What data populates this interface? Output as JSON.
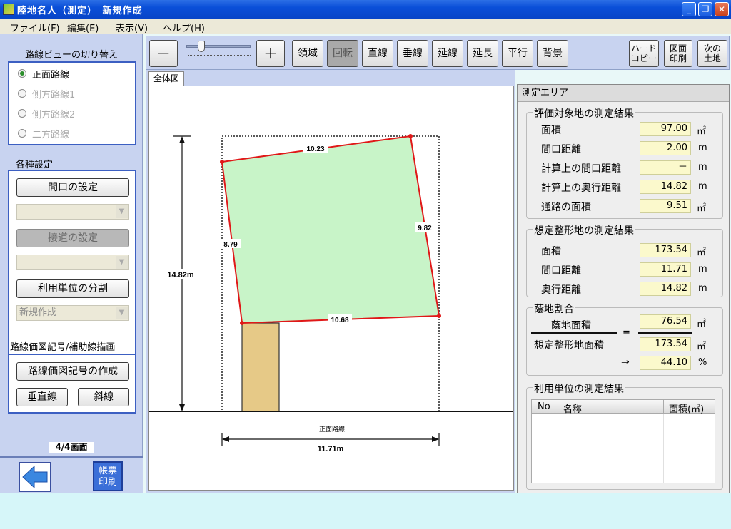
{
  "window": {
    "title": "陸地名人（測定）　新規作成",
    "minimize_icon": "minimize-icon",
    "maximize_icon": "restore-icon",
    "close_icon": "close-icon"
  },
  "menu": {
    "file": "ファイル(F)",
    "edit": "編集(E)",
    "view": "表示(V)",
    "help": "ヘルプ(H)"
  },
  "left": {
    "route_view_title": "路線ビューの切り替え",
    "radios": [
      {
        "label": "正面路線",
        "selected": true
      },
      {
        "label": "側方路線1",
        "selected": false
      },
      {
        "label": "側方路線2",
        "selected": false
      },
      {
        "label": "二方路線",
        "selected": false
      }
    ],
    "settings_title": "各種設定",
    "frontage_button": "間口の設定",
    "road_button": "接道の設定",
    "unit_button": "利用単位の分割",
    "unit_combo_value": "新規作成",
    "drawing_title": "路線価図記号/補助線描画",
    "create_symbol_button": "路線価図記号の作成",
    "vertical_button": "垂直線",
    "diagonal_button": "斜線",
    "pager": "4/4画面",
    "print_button": "帳票印刷"
  },
  "toolbar": {
    "zoom_out": "－",
    "zoom_in": "＋",
    "zoom_level": 0.25,
    "region": "領域",
    "rotate": "回転",
    "line": "直線",
    "perpendicular": "垂線",
    "extend_line": "延線",
    "extension": "延長",
    "parallel": "平行",
    "background": "背景",
    "hardcopy": "ハード\nコピー",
    "drawing_print": "図面\n印刷",
    "next_land": "次の\n土地"
  },
  "canvas": {
    "tab_label": "全体図",
    "dim_top": "10.23",
    "dim_right": "9.82",
    "dim_bottom": "10.68",
    "dim_left": "8.79",
    "dim_depth": "14.82m",
    "road_label": "正面路線",
    "dim_width": "11.71m",
    "colors": {
      "parcel_fill": "#c8f4c8",
      "parcel_edge": "#e01818",
      "passage_fill": "#e6c987"
    }
  },
  "measure": {
    "header": "測定エリア",
    "target_title": "評価対象地の測定結果",
    "target_rows": [
      {
        "label": "面積",
        "value": "97.00",
        "unit": "㎡"
      },
      {
        "label": "間口距離",
        "value": "2.00",
        "unit": "m"
      },
      {
        "label": "計算上の間口距離",
        "value": "－",
        "unit": "m"
      },
      {
        "label": "計算上の奥行距離",
        "value": "14.82",
        "unit": "m"
      },
      {
        "label": "通路の面積",
        "value": "9.51",
        "unit": "㎡"
      }
    ],
    "assumed_title": "想定整形地の測定結果",
    "assumed_rows": [
      {
        "label": "面積",
        "value": "173.54",
        "unit": "㎡"
      },
      {
        "label": "間口距離",
        "value": "11.71",
        "unit": "m"
      },
      {
        "label": "奥行距離",
        "value": "14.82",
        "unit": "m"
      }
    ],
    "ratio_title": "蔭地割合",
    "ratio_numerator_label": "蔭地面積",
    "ratio_numerator_value": "76.54",
    "ratio_denominator_label": "想定整形地面積",
    "ratio_denominator_value": "173.54",
    "ratio_equals": "=",
    "ratio_arrow": "⇒",
    "ratio_result": "44.10",
    "ratio_unit_area": "㎡",
    "ratio_unit_pct": "%",
    "units_title": "利用単位の測定結果",
    "units_columns": [
      "No",
      "名称",
      "面積(㎡)"
    ]
  }
}
